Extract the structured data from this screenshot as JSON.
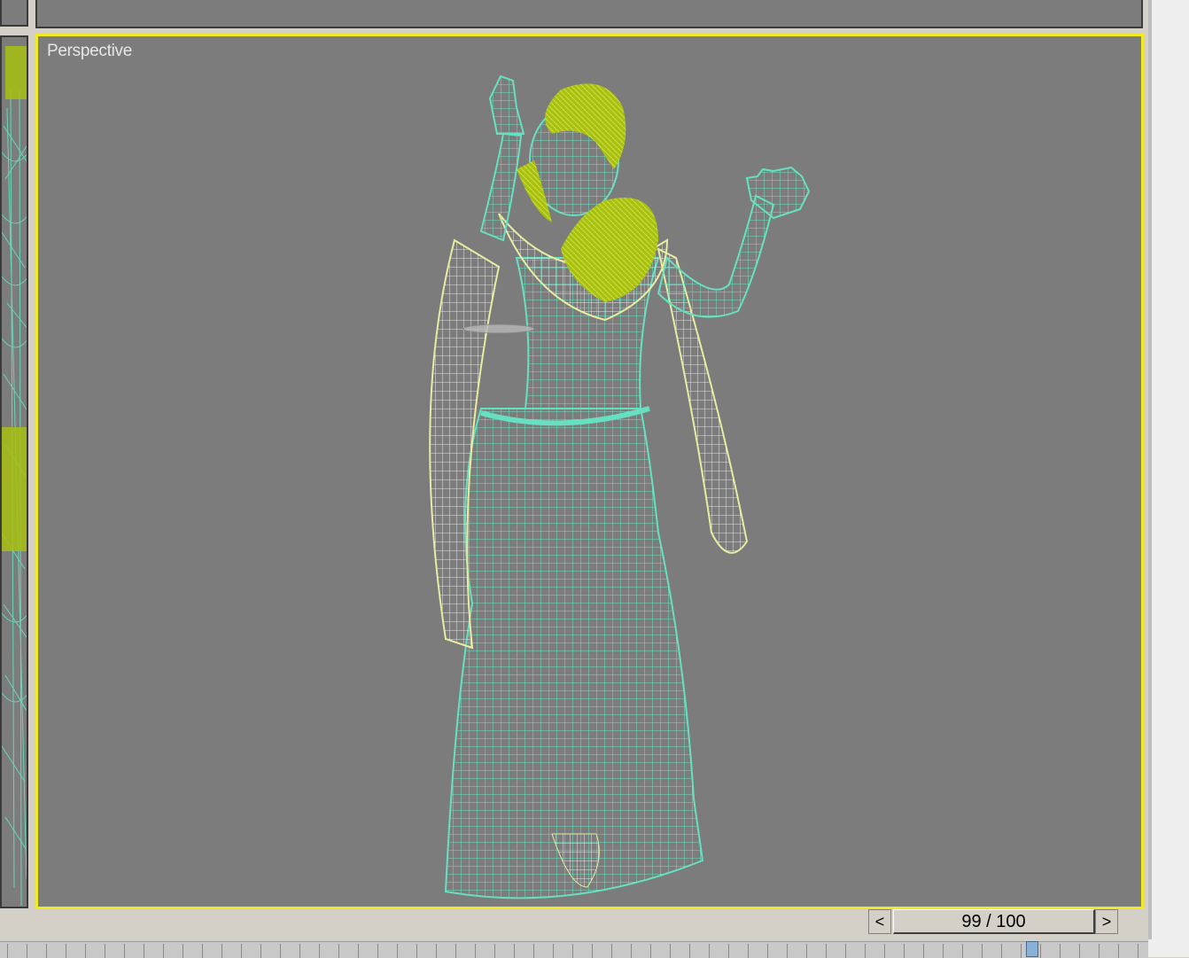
{
  "viewport": {
    "label": "Perspective",
    "active_border_color": "#f1ea22",
    "background_color": "#7c7c7c"
  },
  "wireframe_colors": {
    "body": "#66e0c0",
    "cloth": "#e8eca0",
    "hair": "#a8c010"
  },
  "time_slider": {
    "frame_display": "99 / 100",
    "prev_icon": "chevron-left-icon",
    "next_icon": "chevron-right-icon",
    "prev_glyph": "<",
    "next_glyph": ">",
    "current_frame": 99,
    "total_frames": 100
  }
}
